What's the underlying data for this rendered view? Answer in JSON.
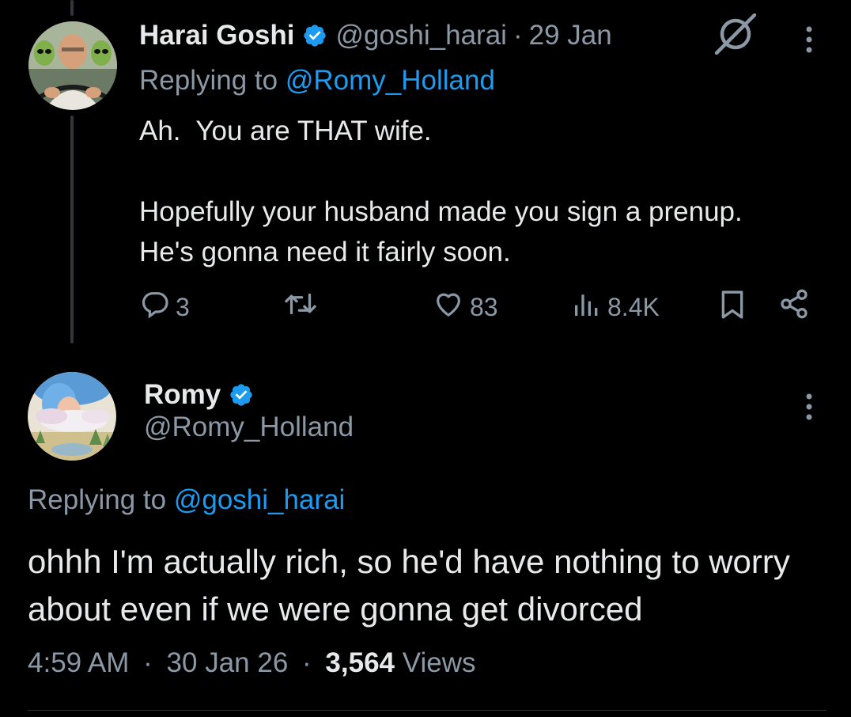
{
  "parent_tweet": {
    "author": {
      "display_name": "Harai Goshi",
      "handle": "@goshi_harai",
      "verified": true,
      "avatar_icon": "avatar-man-driving-with-aliens"
    },
    "dot": "·",
    "date": "29 Jan",
    "replying_prefix": "Replying to ",
    "replying_to": "@Romy_Holland",
    "text": "Ah.  You are THAT wife.\n\nHopefully your husband made you sign a prenup.\nHe's gonna need it fairly soon.",
    "stats": {
      "replies": "3",
      "retweets": "",
      "likes": "83",
      "views": "8.4K"
    },
    "icons": [
      "grok-icon",
      "more-icon",
      "reply-icon",
      "retweet-icon",
      "heart-icon",
      "views-icon",
      "bookmark-icon",
      "share-icon"
    ]
  },
  "focus_tweet": {
    "author": {
      "display_name": "Romy",
      "handle": "@Romy_Holland",
      "verified": true,
      "avatar_icon": "avatar-woman-with-clouds"
    },
    "replying_prefix": "Replying to ",
    "replying_to": "@goshi_harai",
    "text": "ohhh I'm actually rich, so he'd have nothing to worry about even if we were gonna get divorced",
    "time": "4:59 AM",
    "dot": "·",
    "date": "30 Jan 26",
    "views_count": "3,564",
    "views_label": " Views"
  },
  "colors": {
    "background": "#000000",
    "text_primary": "#e7e9ea",
    "text_secondary": "#8b98a5",
    "accent": "#1d9bf0",
    "thread_line": "#333639"
  }
}
